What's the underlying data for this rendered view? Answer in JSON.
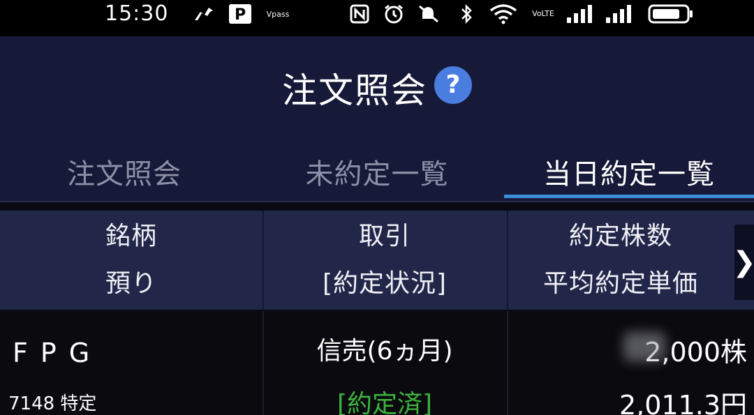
{
  "status_bar": {
    "time": "15:30",
    "left_icons": [
      "running-person-icon",
      "p-pay-icon",
      "vpass-icon"
    ],
    "vpass_text": "Vpass",
    "right_icons": [
      "nfc-icon",
      "alarm-icon",
      "mute-icon",
      "bluetooth-icon",
      "wifi-icon",
      "volte-icon",
      "signal-icon",
      "signal-icon",
      "battery-icon"
    ],
    "volte_text": "VoLTE"
  },
  "header": {
    "title": "注文照会",
    "help_symbol": "?"
  },
  "tabs": [
    {
      "label": "注文照会",
      "active": false
    },
    {
      "label": "未約定一覧",
      "active": false
    },
    {
      "label": "当日約定一覧",
      "active": true
    }
  ],
  "columns": [
    {
      "line1": "銘柄",
      "line2": "預り"
    },
    {
      "line1": "取引",
      "line2": "[約定状況]"
    },
    {
      "line1": "約定株数",
      "line2": "平均約定単価"
    }
  ],
  "scroll_symbol": "❯",
  "rows": [
    {
      "name": "FPG",
      "code_account": "7148 特定",
      "trade": "信売(6ヵ月)",
      "status": "[約定済]",
      "quantity": "2,000株",
      "price": "2,011.3円"
    }
  ],
  "colors": {
    "header_bg": "#161937",
    "column_header_bg": "#22274a",
    "tab_indicator": "#3a8fd6",
    "status_done": "#3db33d",
    "help_button": "#4a7de0"
  }
}
